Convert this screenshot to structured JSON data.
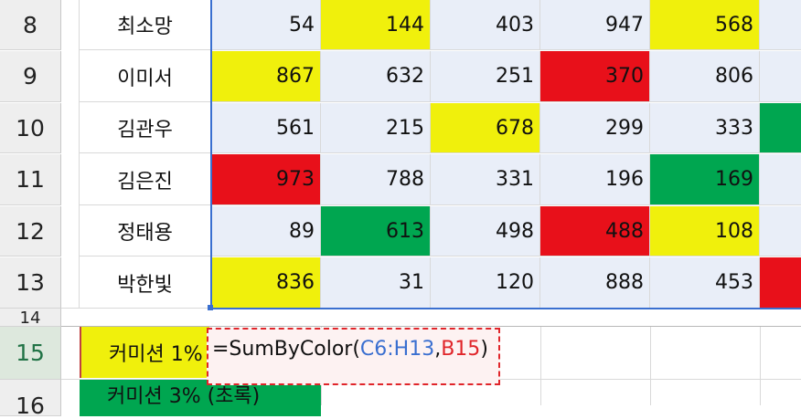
{
  "rows": [
    {
      "row": "8",
      "name": "최소망",
      "values": [
        "54",
        "144",
        "403",
        "947",
        "568"
      ],
      "colors": [
        "",
        "yellow",
        "",
        "",
        "yellow",
        ""
      ]
    },
    {
      "row": "9",
      "name": "이미서",
      "values": [
        "867",
        "632",
        "251",
        "370",
        "806"
      ],
      "colors": [
        "yellow",
        "",
        "",
        "red",
        "",
        ""
      ]
    },
    {
      "row": "10",
      "name": "김관우",
      "values": [
        "561",
        "215",
        "678",
        "299",
        "333"
      ],
      "colors": [
        "",
        "",
        "yellow",
        "",
        "",
        "green"
      ]
    },
    {
      "row": "11",
      "name": "김은진",
      "values": [
        "973",
        "788",
        "331",
        "196",
        "169"
      ],
      "colors": [
        "red",
        "",
        "",
        "",
        "green",
        ""
      ]
    },
    {
      "row": "12",
      "name": "정태용",
      "values": [
        "89",
        "613",
        "498",
        "488",
        "108"
      ],
      "colors": [
        "",
        "green",
        "",
        "red",
        "yellow",
        ""
      ]
    },
    {
      "row": "13",
      "name": "박한빛",
      "values": [
        "836",
        "31",
        "120",
        "888",
        "453"
      ],
      "colors": [
        "yellow",
        "",
        "",
        "",
        "",
        "red"
      ]
    }
  ],
  "row14": "14",
  "row15": {
    "row": "15",
    "label": "커미션 1%"
  },
  "row16": {
    "row": "16",
    "label": "커미션 3% (초록)"
  },
  "formula": {
    "prefix": "=SumByColor(",
    "range": "C6:H13",
    "sep": ",",
    "ref": "B15",
    "suffix": ")"
  },
  "colors": {
    "yellow": "#f0f00c",
    "red": "#e8101a",
    "green": "#00a650",
    "selection": "#e9eef8",
    "accent": "#3a6fd0"
  }
}
